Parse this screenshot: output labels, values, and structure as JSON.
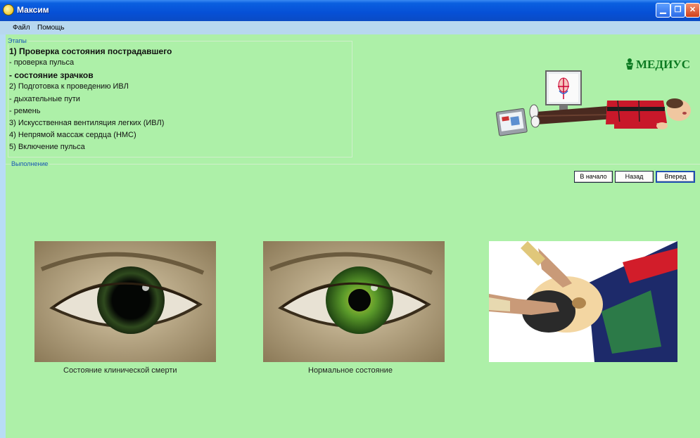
{
  "window": {
    "title": "Максим",
    "controls": [
      "minimize-icon",
      "restore-icon",
      "close-icon"
    ]
  },
  "menu": [
    "Файл",
    "Помощь"
  ],
  "stages": {
    "label": "Этапы",
    "items": [
      {
        "text": "1) Проверка состояния пострадавшего",
        "bold": true
      },
      {
        "text": "- проверка пульса",
        "bold": false
      },
      {
        "text": "- состояние зрачков",
        "bold": true
      },
      {
        "text": "2) Подготовка к проведению ИВЛ",
        "bold": false
      },
      {
        "text": "- дыхательные пути",
        "bold": false
      },
      {
        "text": "- ремень",
        "bold": false
      },
      {
        "text": "3) Искусственная вентиляция легких (ИВЛ)",
        "bold": false
      },
      {
        "text": "4) Непрямой массаж сердца (НМС)",
        "bold": false
      },
      {
        "text": "5) Включение пульса",
        "bold": false
      }
    ]
  },
  "logo": {
    "text": "МЕДИУС",
    "color": "#0c7a22"
  },
  "execution": {
    "label": "Выполнение",
    "buttons": {
      "start": "В начало",
      "back": "Назад",
      "forward": "Вперед"
    }
  },
  "photos": [
    {
      "caption": "Состояние клинической смерти"
    },
    {
      "caption": "Нормальное состояние"
    },
    {
      "caption": ""
    }
  ],
  "colors": {
    "background": "#adf0a8",
    "titlebar": "#0650d6",
    "label": "#1a58b5"
  }
}
